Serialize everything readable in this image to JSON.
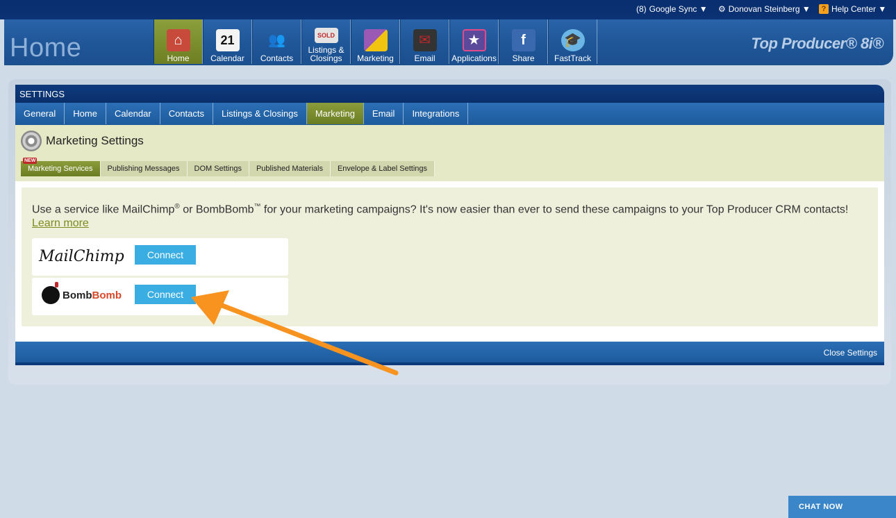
{
  "topbar": {
    "google_sync": "Google Sync ▼",
    "user": "Donovan Steinberg ▼",
    "help": "Help Center ▼"
  },
  "header": {
    "page_title": "Home",
    "brand": "Top Producer® 8i®"
  },
  "nav": [
    {
      "label": "Home",
      "icon": "house-icon"
    },
    {
      "label": "Calendar",
      "icon": "calendar-icon"
    },
    {
      "label": "Contacts",
      "icon": "contacts-icon"
    },
    {
      "label": "Listings & Closings",
      "icon": "sold-sign-icon"
    },
    {
      "label": "Marketing",
      "icon": "puzzle-icon"
    },
    {
      "label": "Email",
      "icon": "mailbox-icon"
    },
    {
      "label": "Applications",
      "icon": "applications-icon"
    },
    {
      "label": "Share",
      "icon": "share-icon"
    },
    {
      "label": "FastTrack",
      "icon": "graduation-cap-icon"
    }
  ],
  "calendar_day": "21",
  "settings": {
    "title": "SETTINGS",
    "tabs": [
      "General",
      "Home",
      "Calendar",
      "Contacts",
      "Listings & Closings",
      "Marketing",
      "Email",
      "Integrations"
    ],
    "section_title": "Marketing Settings",
    "subtabs": [
      "Marketing Services",
      "Publishing Messages",
      "DOM Settings",
      "Published Materials",
      "Envelope & Label Settings"
    ],
    "new_badge": "NEW",
    "intro_1": "Use a service like MailChimp",
    "intro_reg": "®",
    "intro_2": " or BombBomb",
    "intro_tm": "™",
    "intro_3": " for your marketing campaigns? It's now easier than ever to send these campaigns to your Top Producer CRM contacts! ",
    "learn_more": "Learn more",
    "services": [
      {
        "name": "MailChimp",
        "button": "Connect"
      },
      {
        "name_part1": "Bomb",
        "name_part2": "Bomb",
        "button": "Connect"
      }
    ],
    "close": "Close Settings"
  },
  "chat": "CHAT NOW",
  "colors": {
    "accent_green": "#7a8c2c",
    "connect_blue": "#3aaee3",
    "arrow_orange": "#f7931e"
  }
}
